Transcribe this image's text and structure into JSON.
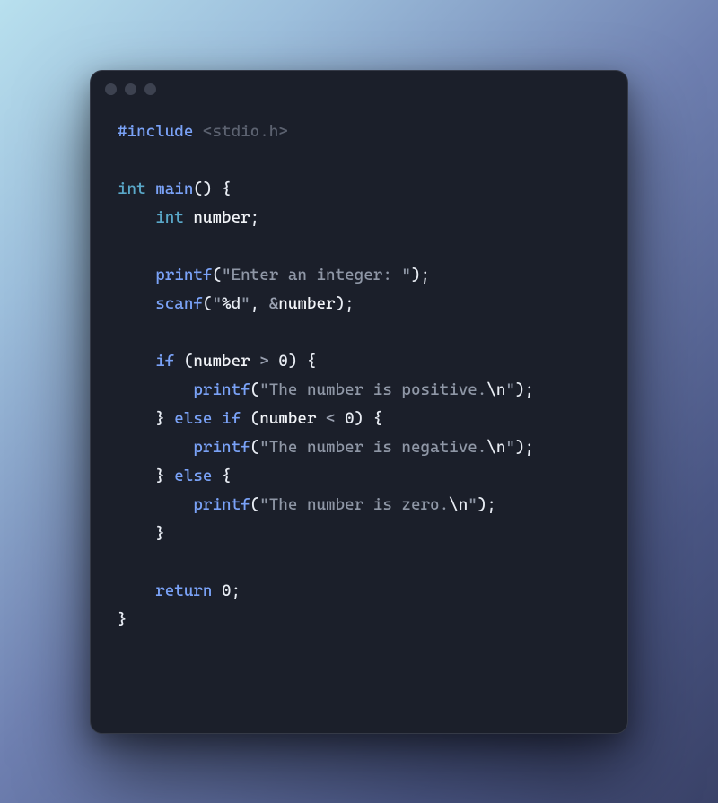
{
  "code": {
    "tokens": [
      {
        "cls": "tok-preproc",
        "text": "#include"
      },
      {
        "cls": "",
        "text": " "
      },
      {
        "cls": "tok-header",
        "text": "<stdio.h>"
      },
      {
        "text": "\n"
      },
      {
        "text": "\n"
      },
      {
        "cls": "tok-type",
        "text": "int"
      },
      {
        "text": " "
      },
      {
        "cls": "tok-keyword",
        "text": "main"
      },
      {
        "cls": "tok-punct",
        "text": "() {"
      },
      {
        "text": "\n"
      },
      {
        "text": "    "
      },
      {
        "cls": "tok-type",
        "text": "int"
      },
      {
        "text": " "
      },
      {
        "cls": "tok-ident",
        "text": "number"
      },
      {
        "cls": "tok-punct",
        "text": ";"
      },
      {
        "text": "\n"
      },
      {
        "text": "\n"
      },
      {
        "text": "    "
      },
      {
        "cls": "tok-func",
        "text": "printf"
      },
      {
        "cls": "tok-punct",
        "text": "("
      },
      {
        "cls": "tok-string",
        "text": "\"Enter an integer: \""
      },
      {
        "cls": "tok-punct",
        "text": ");"
      },
      {
        "text": "\n"
      },
      {
        "text": "    "
      },
      {
        "cls": "tok-func",
        "text": "scanf"
      },
      {
        "cls": "tok-punct",
        "text": "("
      },
      {
        "cls": "tok-string",
        "text": "\""
      },
      {
        "cls": "tok-fmt",
        "text": "%d"
      },
      {
        "cls": "tok-string",
        "text": "\""
      },
      {
        "cls": "tok-punct",
        "text": ", "
      },
      {
        "cls": "tok-op",
        "text": "&"
      },
      {
        "cls": "tok-ident",
        "text": "number"
      },
      {
        "cls": "tok-punct",
        "text": ");"
      },
      {
        "text": "\n"
      },
      {
        "text": "\n"
      },
      {
        "text": "    "
      },
      {
        "cls": "tok-keyword",
        "text": "if"
      },
      {
        "text": " "
      },
      {
        "cls": "tok-punct",
        "text": "("
      },
      {
        "cls": "tok-ident",
        "text": "number"
      },
      {
        "text": " "
      },
      {
        "cls": "tok-op",
        "text": ">"
      },
      {
        "text": " "
      },
      {
        "cls": "tok-num",
        "text": "0"
      },
      {
        "cls": "tok-punct",
        "text": ") {"
      },
      {
        "text": "\n"
      },
      {
        "text": "        "
      },
      {
        "cls": "tok-func",
        "text": "printf"
      },
      {
        "cls": "tok-punct",
        "text": "("
      },
      {
        "cls": "tok-string",
        "text": "\"The number is positive."
      },
      {
        "cls": "tok-esc",
        "text": "\\n"
      },
      {
        "cls": "tok-string",
        "text": "\""
      },
      {
        "cls": "tok-punct",
        "text": ");"
      },
      {
        "text": "\n"
      },
      {
        "text": "    "
      },
      {
        "cls": "tok-punct",
        "text": "}"
      },
      {
        "text": " "
      },
      {
        "cls": "tok-keyword",
        "text": "else if"
      },
      {
        "text": " "
      },
      {
        "cls": "tok-punct",
        "text": "("
      },
      {
        "cls": "tok-ident",
        "text": "number"
      },
      {
        "text": " "
      },
      {
        "cls": "tok-op",
        "text": "<"
      },
      {
        "text": " "
      },
      {
        "cls": "tok-num",
        "text": "0"
      },
      {
        "cls": "tok-punct",
        "text": ") {"
      },
      {
        "text": "\n"
      },
      {
        "text": "        "
      },
      {
        "cls": "tok-func",
        "text": "printf"
      },
      {
        "cls": "tok-punct",
        "text": "("
      },
      {
        "cls": "tok-string",
        "text": "\"The number is negative."
      },
      {
        "cls": "tok-esc",
        "text": "\\n"
      },
      {
        "cls": "tok-string",
        "text": "\""
      },
      {
        "cls": "tok-punct",
        "text": ");"
      },
      {
        "text": "\n"
      },
      {
        "text": "    "
      },
      {
        "cls": "tok-punct",
        "text": "}"
      },
      {
        "text": " "
      },
      {
        "cls": "tok-keyword",
        "text": "else"
      },
      {
        "text": " "
      },
      {
        "cls": "tok-punct",
        "text": "{"
      },
      {
        "text": "\n"
      },
      {
        "text": "        "
      },
      {
        "cls": "tok-func",
        "text": "printf"
      },
      {
        "cls": "tok-punct",
        "text": "("
      },
      {
        "cls": "tok-string",
        "text": "\"The number is zero."
      },
      {
        "cls": "tok-esc",
        "text": "\\n"
      },
      {
        "cls": "tok-string",
        "text": "\""
      },
      {
        "cls": "tok-punct",
        "text": ");"
      },
      {
        "text": "\n"
      },
      {
        "text": "    "
      },
      {
        "cls": "tok-punct",
        "text": "}"
      },
      {
        "text": "\n"
      },
      {
        "text": "\n"
      },
      {
        "text": "    "
      },
      {
        "cls": "tok-keyword",
        "text": "return"
      },
      {
        "text": " "
      },
      {
        "cls": "tok-num",
        "text": "0"
      },
      {
        "cls": "tok-punct",
        "text": ";"
      },
      {
        "text": "\n"
      },
      {
        "cls": "tok-punct",
        "text": "}"
      }
    ]
  }
}
